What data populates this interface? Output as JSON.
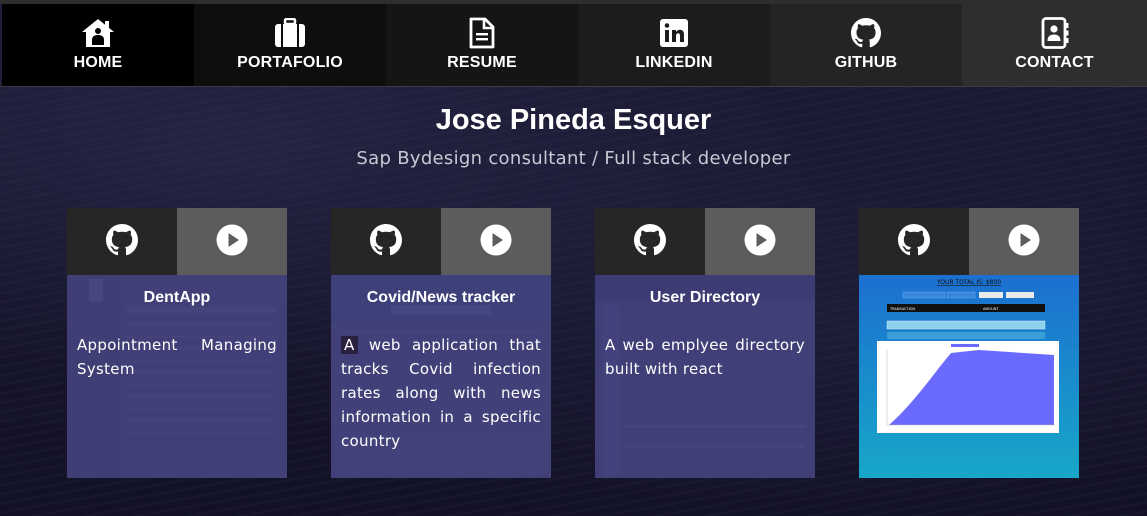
{
  "nav": {
    "items": [
      {
        "label": "HOME",
        "icon": "home-icon",
        "bg": "#000000"
      },
      {
        "label": "PORTAFOLIO",
        "icon": "briefcase-icon",
        "bg": "#0e0e0e"
      },
      {
        "label": "RESUME",
        "icon": "document-icon",
        "bg": "#151515"
      },
      {
        "label": "LINKEDIN",
        "icon": "linkedin-icon",
        "bg": "#1c1c1c"
      },
      {
        "label": "GITHUB",
        "icon": "github-icon",
        "bg": "#242424"
      },
      {
        "label": "CONTACT",
        "icon": "contact-card-icon",
        "bg": "#2e2e2e"
      }
    ]
  },
  "header": {
    "name": "Jose Pineda Esquer",
    "tagline": "Sap Bydesign consultant / Full stack developer"
  },
  "projects": [
    {
      "title": "DentApp",
      "desc_first": "",
      "desc": "Appointment Managing System"
    },
    {
      "title": "Covid/News tracker",
      "desc_first": "A",
      "desc": " web application that tracks Covid infection rates along with news information in a specific country"
    },
    {
      "title": "User Directory",
      "desc_first": "",
      "desc": "A web emplyee directory built with react"
    },
    {
      "title": "",
      "desc_first": "",
      "desc": "",
      "screenshot": {
        "heading": "YOUR TOTAL IS: $800",
        "table_headers": [
          "TRANSACTION",
          "AMOUNT"
        ],
        "fill_color": "#6a6aff",
        "bg_color": "#1596c8"
      }
    }
  ],
  "colors": {
    "github_button": "#262626",
    "play_button": "#5c5c5c",
    "card_overlay": "#444280"
  }
}
